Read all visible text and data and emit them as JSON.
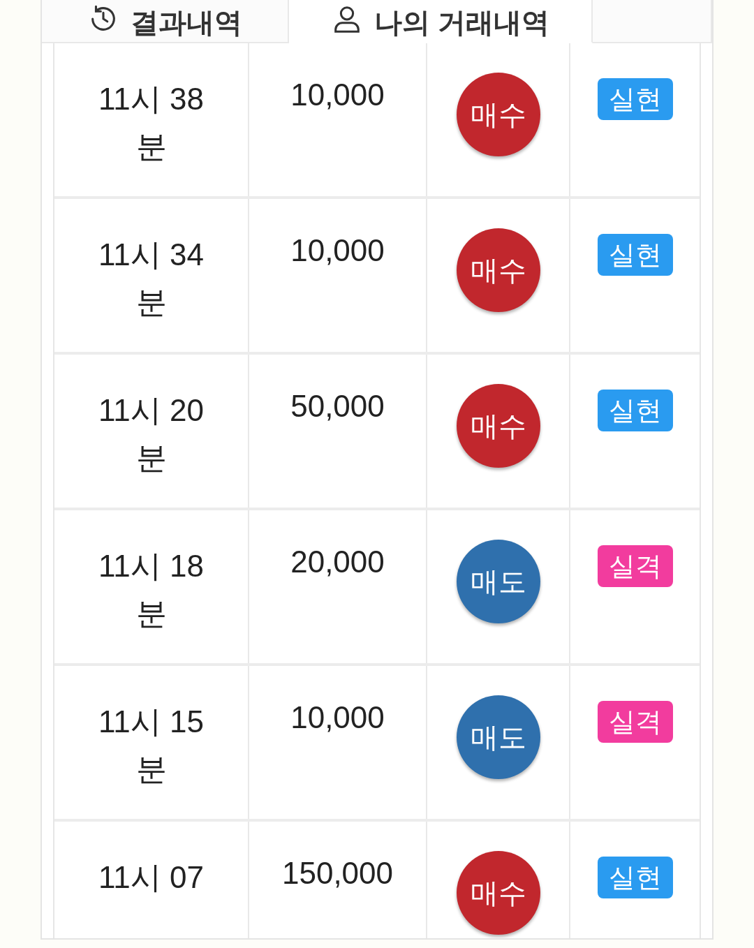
{
  "tabs": [
    {
      "label": "결과내역",
      "kind": "history",
      "selected": false
    },
    {
      "label": "나의 거래내역",
      "kind": "person",
      "selected": true
    },
    {
      "kind": "blank",
      "selected": false
    }
  ],
  "rows": [
    {
      "time": "11시 38 분",
      "amount": "10,000",
      "action": {
        "kind": "buy",
        "label": "매수"
      },
      "result": {
        "kind": "win",
        "label": "실현"
      }
    },
    {
      "time": "11시 34 분",
      "amount": "10,000",
      "action": {
        "kind": "buy",
        "label": "매수"
      },
      "result": {
        "kind": "win",
        "label": "실현"
      }
    },
    {
      "time": "11시 20 분",
      "amount": "50,000",
      "action": {
        "kind": "buy",
        "label": "매수"
      },
      "result": {
        "kind": "win",
        "label": "실현"
      }
    },
    {
      "time": "11시 18 분",
      "amount": "20,000",
      "action": {
        "kind": "sell",
        "label": "매도"
      },
      "result": {
        "kind": "lose",
        "label": "실격"
      }
    },
    {
      "time": "11시 15 분",
      "amount": "10,000",
      "action": {
        "kind": "sell",
        "label": "매도"
      },
      "result": {
        "kind": "lose",
        "label": "실격"
      }
    },
    {
      "time": "11시 07",
      "amount": "150,000",
      "action": {
        "kind": "buy",
        "label": "매수"
      },
      "result": {
        "kind": "win",
        "label": "실현"
      }
    }
  ]
}
